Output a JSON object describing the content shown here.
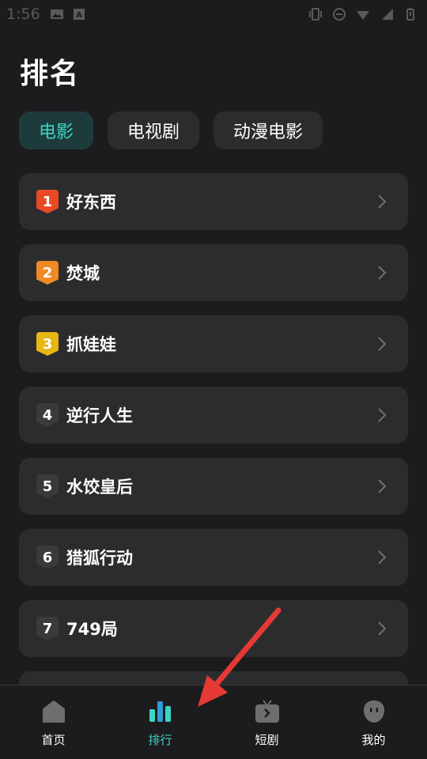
{
  "status_bar": {
    "time": "1:56"
  },
  "page": {
    "title": "排名"
  },
  "tabs": [
    {
      "label": "电影",
      "active": true
    },
    {
      "label": "电视剧",
      "active": false
    },
    {
      "label": "动漫电影",
      "active": false
    }
  ],
  "rank_items": [
    {
      "rank": "1",
      "title": "好东西",
      "badge_color": "#e84a26"
    },
    {
      "rank": "2",
      "title": "焚城",
      "badge_color": "#f08a24"
    },
    {
      "rank": "3",
      "title": "抓娃娃",
      "badge_color": "#e6b614"
    },
    {
      "rank": "4",
      "title": "逆行人生",
      "badge_color": "#3a3a3c"
    },
    {
      "rank": "5",
      "title": "水饺皇后",
      "badge_color": "#3a3a3c"
    },
    {
      "rank": "6",
      "title": "猎狐行动",
      "badge_color": "#3a3a3c"
    },
    {
      "rank": "7",
      "title": "749局",
      "badge_color": "#3a3a3c"
    }
  ],
  "bottom_nav": [
    {
      "label": "首页",
      "icon": "home-icon",
      "active": false
    },
    {
      "label": "排行",
      "icon": "ranking-icon",
      "active": true
    },
    {
      "label": "短剧",
      "icon": "tv-icon",
      "active": false
    },
    {
      "label": "我的",
      "icon": "profile-icon",
      "active": false
    }
  ],
  "colors": {
    "accent": "#3ad6c4",
    "background": "#1c1c1e",
    "card": "#2c2c2e",
    "annotation_arrow": "#e53935"
  }
}
